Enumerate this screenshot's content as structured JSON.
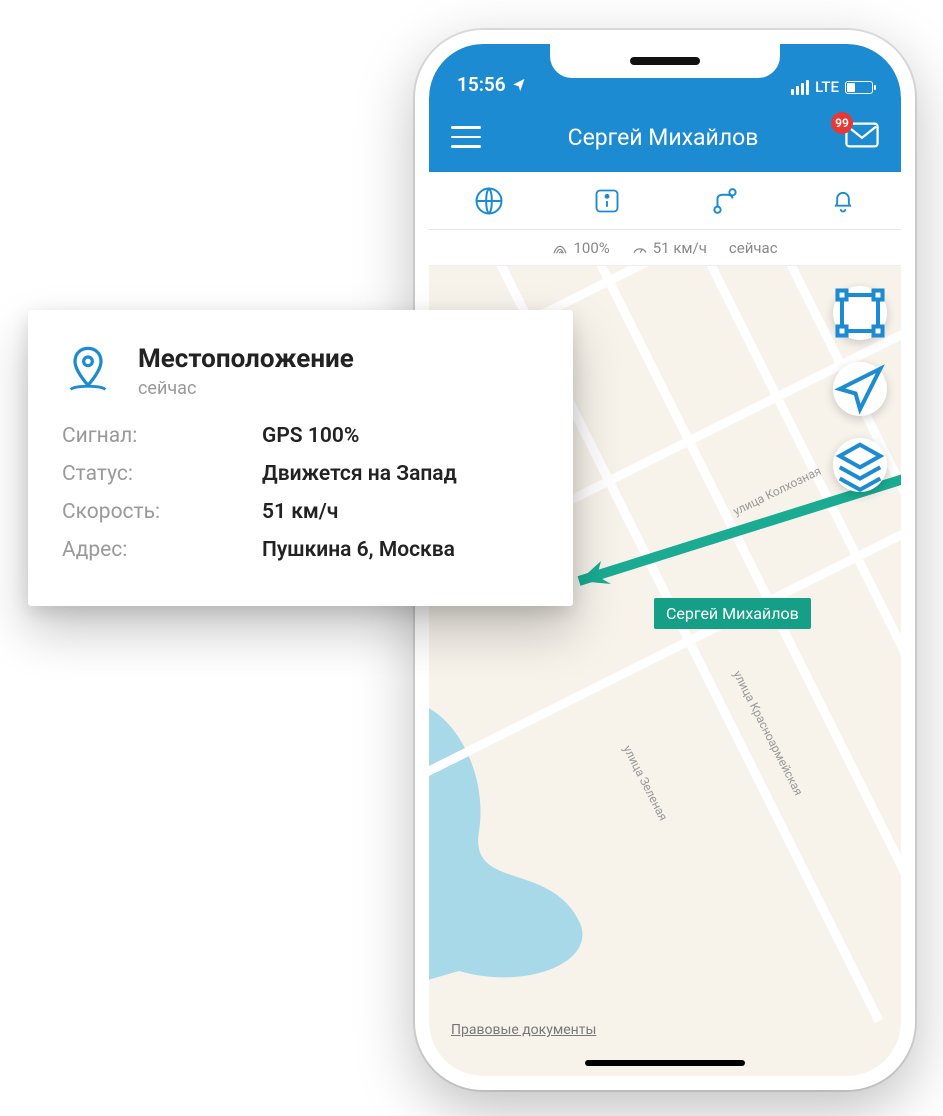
{
  "status": {
    "time": "15:56",
    "network": "LTE"
  },
  "header": {
    "title": "Сергей Михайлов",
    "badge": "99"
  },
  "stats": {
    "signal": "100%",
    "speed": "51 км/ч",
    "time": "сейчас"
  },
  "track": {
    "label": "Сергей Михайлов"
  },
  "legal": "Правовые документы",
  "streets": {
    "kolhoznaya": "улица Колхозная",
    "zelenaya": "улица Зеленая",
    "krasnoarm": "улица Красноармейская"
  },
  "card": {
    "title": "Местоположение",
    "subtitle": "сейчас",
    "signal_k": "Сигнал:",
    "signal_v": "GPS 100%",
    "status_k": "Статус:",
    "status_v": "Движется на Запад",
    "speed_k": "Скорость:",
    "speed_v": "51 км/ч",
    "address_k": "Адрес:",
    "address_v": "Пушкина 6, Москва"
  }
}
